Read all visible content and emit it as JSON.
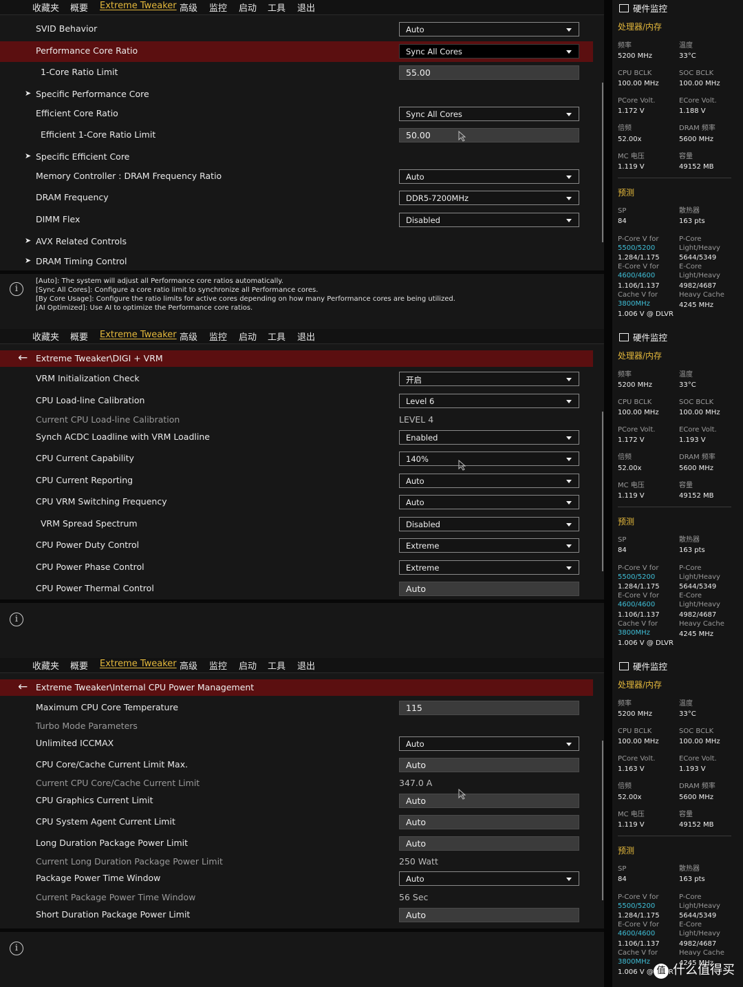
{
  "menu": [
    "收藏夹",
    "概要",
    "Extreme Tweaker",
    "高级",
    "监控",
    "启动",
    "工具",
    "退出"
  ],
  "panel1": {
    "rows": [
      {
        "label": "SVID Behavior",
        "value": "Auto"
      },
      {
        "label": "Performance Core Ratio",
        "value": "Sync All Cores"
      },
      {
        "label": "1-Core Ratio Limit",
        "value": "55.00"
      },
      {
        "label": "Specific Performance Core"
      },
      {
        "label": "Efficient Core Ratio",
        "value": "Sync All Cores"
      },
      {
        "label": "Efficient 1-Core Ratio Limit",
        "value": "50.00"
      },
      {
        "label": "Specific Efficient Core"
      },
      {
        "label": "Memory Controller : DRAM Frequency Ratio",
        "value": "Auto"
      },
      {
        "label": "DRAM Frequency",
        "value": "DDR5-7200MHz"
      },
      {
        "label": "DIMM Flex",
        "value": "Disabled"
      },
      {
        "label": "AVX Related Controls"
      },
      {
        "label": "DRAM Timing Control"
      }
    ],
    "help": [
      "[Auto]: The system will adjust all Performance core ratios automatically.",
      "[Sync All Cores]: Configure a core ratio limit to synchronize all Performance cores.",
      "[By Core Usage]: Configure the ratio limits for active cores depending on how many Performance cores are being utilized.",
      "[AI Optimized]: Use AI to optimize the Performance core ratios."
    ]
  },
  "panel2": {
    "breadcrumb": "Extreme Tweaker\\DIGI + VRM",
    "rows": [
      {
        "label": "VRM Initialization Check",
        "value": "开启"
      },
      {
        "label": "CPU Load-line Calibration",
        "value": "Level 6"
      },
      {
        "label": "Current CPU Load-line Calibration",
        "value": "LEVEL 4"
      },
      {
        "label": "Synch ACDC Loadline with VRM Loadline",
        "value": "Enabled"
      },
      {
        "label": "CPU Current Capability",
        "value": "140%"
      },
      {
        "label": "CPU Current Reporting",
        "value": "Auto"
      },
      {
        "label": "CPU VRM Switching Frequency",
        "value": "Auto"
      },
      {
        "label": "VRM Spread Spectrum",
        "value": "Disabled"
      },
      {
        "label": "CPU Power Duty Control",
        "value": "Extreme"
      },
      {
        "label": "CPU Power Phase Control",
        "value": "Extreme"
      },
      {
        "label": "CPU Power Thermal Control",
        "value": "Auto"
      }
    ]
  },
  "panel3": {
    "breadcrumb": "Extreme Tweaker\\Internal CPU Power Management",
    "rows": [
      {
        "label": "Maximum CPU Core Temperature",
        "value": "115"
      },
      {
        "label": "Turbo Mode Parameters"
      },
      {
        "label": "Unlimited ICCMAX",
        "value": "Auto"
      },
      {
        "label": "CPU Core/Cache Current Limit Max.",
        "value": "Auto"
      },
      {
        "label": "Current CPU Core/Cache Current Limit",
        "value": "347.0 A"
      },
      {
        "label": "CPU Graphics Current Limit",
        "value": "Auto"
      },
      {
        "label": "CPU System Agent Current Limit",
        "value": "Auto"
      },
      {
        "label": "Long Duration Package Power Limit",
        "value": "Auto"
      },
      {
        "label": "Current Long Duration Package Power Limit",
        "value": "250 Watt"
      },
      {
        "label": "Package Power Time Window",
        "value": "Auto"
      },
      {
        "label": "Current Package Power Time Window",
        "value": "56 Sec"
      },
      {
        "label": "Short Duration Package Power Limit",
        "value": "Auto"
      }
    ]
  },
  "sidebar": {
    "title": "硬件监控",
    "section_cpu": "处理器/内存",
    "section_predict": "预测",
    "labels": {
      "freq": "频率",
      "temp": "温度",
      "cpu_bclk": "CPU BCLK",
      "soc_bclk": "SOC BCLK",
      "pcore_volt": "PCore Volt.",
      "ecore_volt": "ECore Volt.",
      "ratio": "倍频",
      "dram_freq": "DRAM 频率",
      "mc_volt": "MC 电压",
      "capacity": "容量",
      "sp": "SP",
      "cooler": "散热器",
      "pv_for": "P-Core V for",
      "p_core": "P-Core",
      "light_heavy": "Light/Heavy",
      "ev_for": "E-Core V for",
      "e_core": "E-Core",
      "cache_v_for": "Cache V for",
      "heavy_cache": "Heavy Cache"
    },
    "panels": [
      {
        "freq": "5200 MHz",
        "temp": "33°C",
        "cpu_bclk": "100.00 MHz",
        "soc_bclk": "100.00 MHz",
        "pcore_volt": "1.172 V",
        "ecore_volt": "1.188 V",
        "ratio": "52.00x",
        "dram_freq": "5600 MHz",
        "mc_volt": "1.119 V",
        "capacity": "49152 MB"
      },
      {
        "freq": "5200 MHz",
        "temp": "33°C",
        "cpu_bclk": "100.00 MHz",
        "soc_bclk": "100.00 MHz",
        "pcore_volt": "1.172 V",
        "ecore_volt": "1.193 V",
        "ratio": "52.00x",
        "dram_freq": "5600 MHz",
        "mc_volt": "1.119 V",
        "capacity": "49152 MB"
      },
      {
        "freq": "5200 MHz",
        "temp": "33°C",
        "cpu_bclk": "100.00 MHz",
        "soc_bclk": "100.00 MHz",
        "pcore_volt": "1.163 V",
        "ecore_volt": "1.193 V",
        "ratio": "52.00x",
        "dram_freq": "5600 MHz",
        "mc_volt": "1.119 V",
        "capacity": "49152 MB"
      }
    ],
    "predict": {
      "sp": "84",
      "cooler": "163 pts",
      "pv_freq": "5500/5200",
      "pv_val": "1.284/1.175",
      "p_lh": "5644/5349",
      "ev_freq": "4600/4600",
      "ev_val": "1.106/1.137",
      "e_lh": "4982/4687",
      "cache_freq": "3800MHz",
      "cache_val": "1.006 V @ DLVR",
      "heavy_cache": "4245 MHz"
    }
  },
  "watermark": {
    "logo": "值",
    "text": "什么值得买"
  },
  "colors": {
    "accent": "#e5b93c",
    "highlight": "#5b0f10",
    "cyan": "#3fbfd8"
  }
}
